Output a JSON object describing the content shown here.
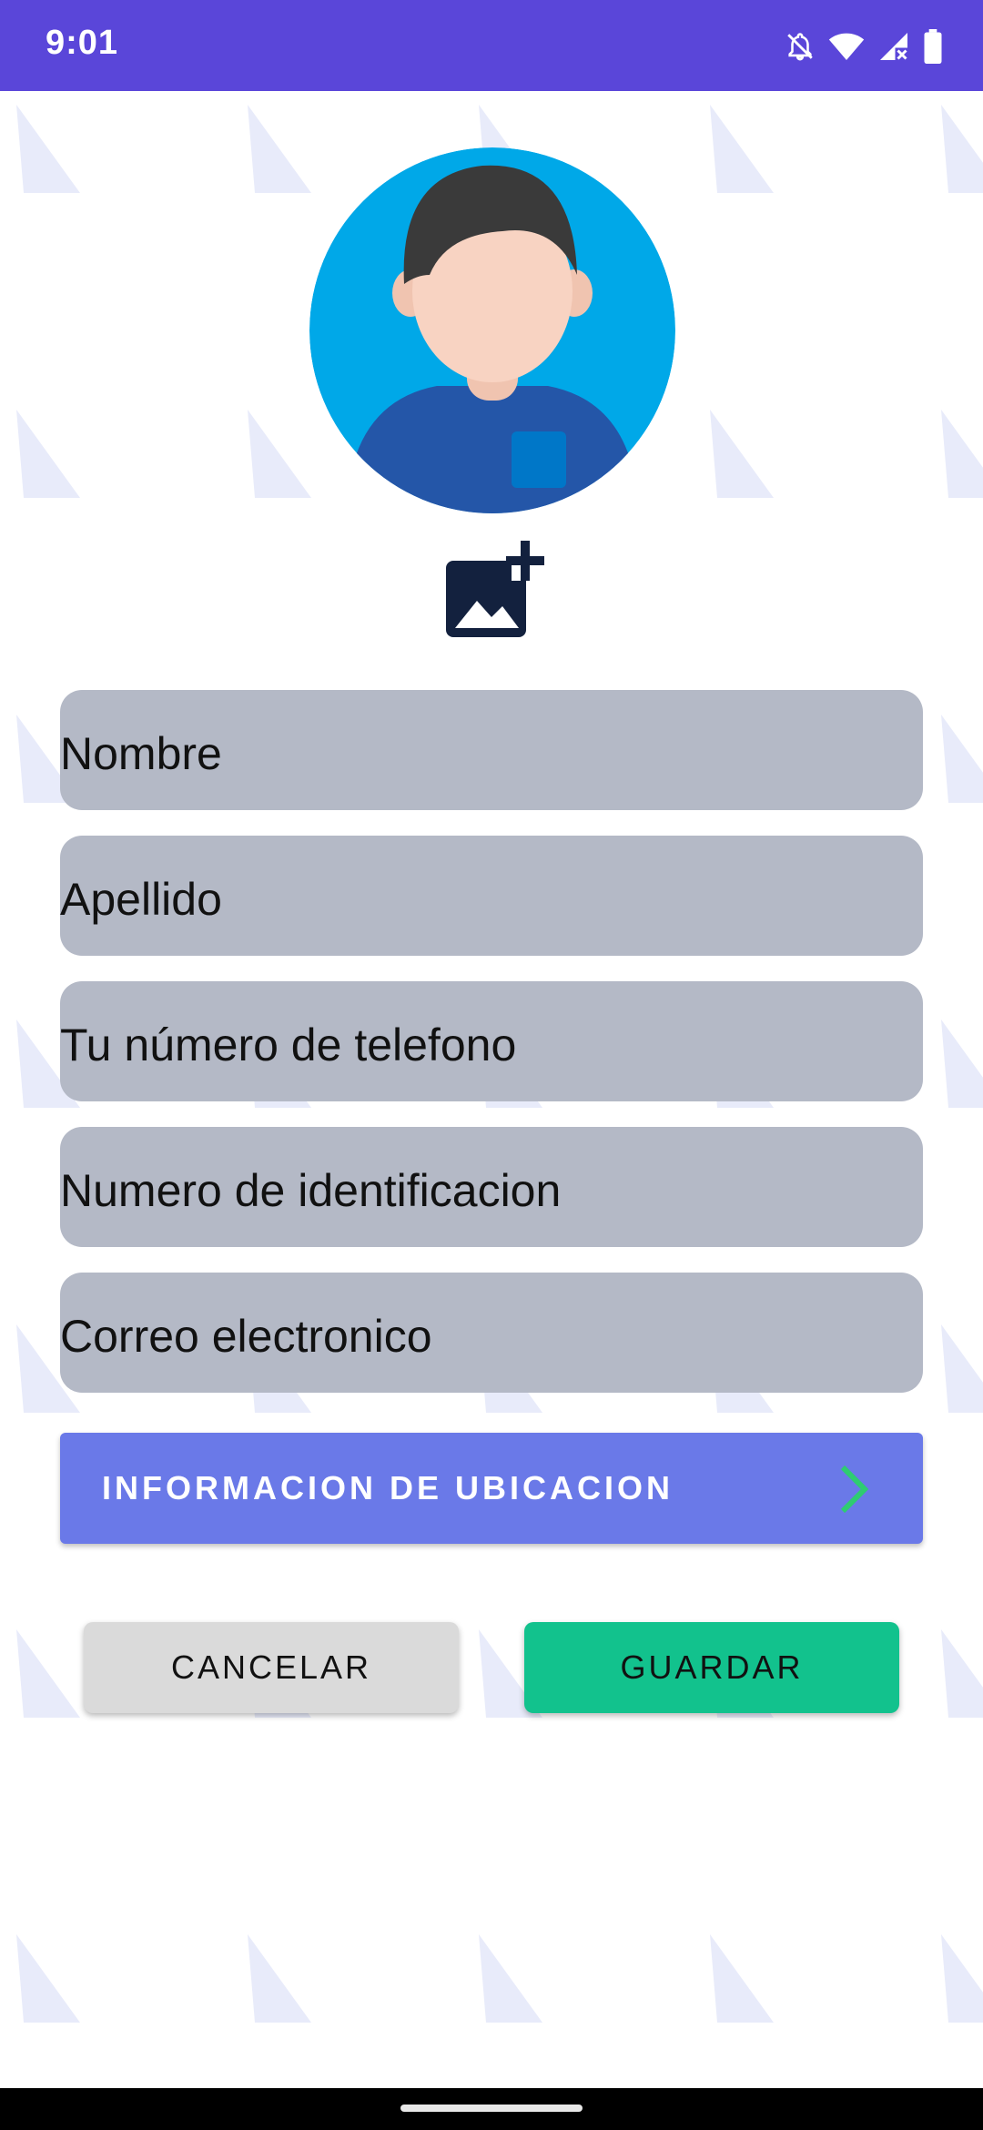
{
  "status_bar": {
    "time": "9:01",
    "icons": [
      "bell-off-icon",
      "wifi-icon",
      "signal-icon",
      "battery-icon"
    ]
  },
  "profile": {
    "avatar_icon": "user-avatar-icon",
    "add_photo_icon": "add-photo-icon"
  },
  "form": {
    "fields": [
      {
        "label": "Nombre"
      },
      {
        "label": "Apellido"
      },
      {
        "label": "Tu número de telefono"
      },
      {
        "label": "Numero de identificacion"
      },
      {
        "label": "Correo electronico"
      }
    ]
  },
  "location_button": {
    "label": "INFORMACION DE UBICACION",
    "icon": "chevron-right-icon",
    "accent": "#6a79e8"
  },
  "actions": {
    "cancel_label": "CANCELAR",
    "save_label": "GUARDAR",
    "save_color": "#12c28d"
  },
  "colors": {
    "status_bar": "#5a46d9",
    "field_bg": "#b4b9c6"
  }
}
